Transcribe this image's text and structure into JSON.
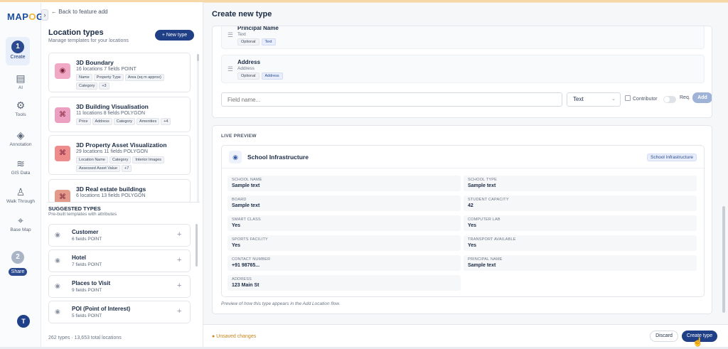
{
  "brand": {
    "logo_a": "MAP",
    "logo_o": "O",
    "logo_b": "G"
  },
  "rail": {
    "toggle_icon": "›",
    "steps": [
      {
        "number": "1",
        "label": "Create",
        "color": "#2c4a8f"
      },
      {
        "number": "2",
        "label": "Share",
        "color": "#a9b4c6"
      }
    ],
    "items": [
      {
        "label": "AI",
        "icon": "ai-icon",
        "glyph": "▤"
      },
      {
        "label": "Tools",
        "icon": "gear-icon",
        "glyph": "⚙"
      },
      {
        "label": "Annotation",
        "icon": "paint-bucket-icon",
        "glyph": "◈"
      },
      {
        "label": "GIS Data",
        "icon": "layers-icon",
        "glyph": "≋"
      },
      {
        "label": "Walk Through",
        "icon": "walking-person-icon",
        "glyph": "♙"
      },
      {
        "label": "Base Map",
        "icon": "map-pin-icon",
        "glyph": "⌖"
      }
    ],
    "avatar": "T"
  },
  "library": {
    "back": "← Back to feature add",
    "title": "Location types",
    "subtitle": "Manage templates for your locations",
    "new_type": "+ New type",
    "types": [
      {
        "name": "3D Boundary",
        "meta": "16 locations   7 fields   POINT",
        "color": "#f0a8c4",
        "glyph": "◉",
        "tags": [
          "Name",
          "Property Type",
          "Area (sq m approx)",
          "Category",
          "+3"
        ]
      },
      {
        "name": "3D Building Visualisation",
        "meta": "11 locations   8 fields   POLYGON",
        "color": "#ec9fc0",
        "glyph": "⌘",
        "tags": [
          "Price",
          "Address",
          "Category",
          "Amenities",
          "+4"
        ]
      },
      {
        "name": "3D Property Asset Visualization",
        "meta": "29 locations   11 fields   POLYGON",
        "color": "#ee8c8c",
        "glyph": "⌘",
        "tags": [
          "Location Name",
          "Category",
          "Interior Images",
          "Assessed Asset Value",
          "+7"
        ]
      },
      {
        "name": "3D Real estate buildings",
        "meta": "6 locations   13 fields   POLYGON",
        "color": "#e39a8a",
        "glyph": "⌘",
        "tags": []
      }
    ],
    "suggested_title": "SUGGESTED TYPES",
    "suggested_sub": "Pre-built templates with attributes",
    "suggested": [
      {
        "name": "Customer",
        "meta": "6 fields   POINT"
      },
      {
        "name": "Hotel",
        "meta": "7 fields   POINT"
      },
      {
        "name": "Places to Visit",
        "meta": "9 fields   POINT"
      },
      {
        "name": "POI (Point of Interest)",
        "meta": "5 fields   POINT"
      }
    ],
    "footer": "262 types · 13,653 total locations"
  },
  "main": {
    "title": "Create new type",
    "fields": [
      {
        "name": "Principal Name",
        "sub": "Text",
        "badges": [
          "Optional",
          "Text"
        ]
      },
      {
        "name": "Address",
        "sub": "Address",
        "badges": [
          "Optional",
          "Address"
        ]
      }
    ],
    "field_input_placeholder": "Field name...",
    "type_select": "Text",
    "contributor": "Contributor",
    "req": "Req.",
    "add": "Add",
    "preview": {
      "label": "LIVE PREVIEW",
      "name": "School Infrastructure",
      "badge": "School Infrastructure",
      "fields": [
        {
          "label": "SCHOOL NAME",
          "value": "Sample text"
        },
        {
          "label": "SCHOOL TYPE",
          "value": "Sample text"
        },
        {
          "label": "BOARD",
          "value": "Sample text"
        },
        {
          "label": "STUDENT CAPACITY",
          "value": "42"
        },
        {
          "label": "SMART CLASS",
          "value": "Yes"
        },
        {
          "label": "COMPUTER LAB",
          "value": "Yes"
        },
        {
          "label": "SPORTS FACILITY",
          "value": "Yes"
        },
        {
          "label": "TRANSPORT AVAILABLE",
          "value": "Yes"
        },
        {
          "label": "CONTACT NUMBER",
          "value": "+91 98765..."
        },
        {
          "label": "PRINCIPAL NAME",
          "value": "Sample text"
        },
        {
          "label": "ADDRESS",
          "value": "123 Main St"
        }
      ],
      "note": "Preview of how this type appears in the Add Location flow."
    },
    "unsaved": "● Unsaved changes",
    "discard": "Discard",
    "create": "Create type"
  }
}
